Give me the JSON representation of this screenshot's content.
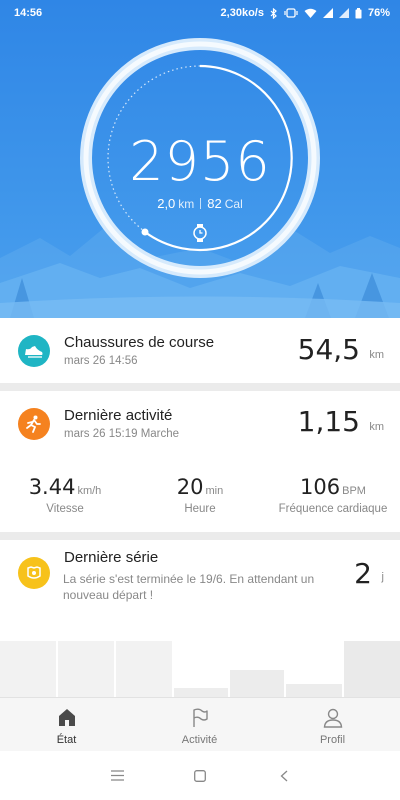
{
  "status_bar": {
    "time": "14:56",
    "network_speed": "2,30ko/s",
    "battery": "76%",
    "icons": [
      "bluetooth-icon",
      "vibrate-icon",
      "wifi-icon",
      "signal-icon",
      "signal-icon",
      "battery-icon"
    ]
  },
  "hero": {
    "steps": "2956",
    "distance_value": "2,0",
    "distance_unit": "km",
    "calories_value": "82",
    "calories_unit": "Cal",
    "device_icon": "watch-icon",
    "colors": {
      "background": "#3d94ea",
      "ring": "#ffffff"
    }
  },
  "shoes": {
    "icon": "shoe-icon",
    "title": "Chaussures de course",
    "subtitle": "mars 26 14:56",
    "value": "54,5",
    "unit": "km",
    "color": "#1fb5c4"
  },
  "activity": {
    "icon": "running-icon",
    "title": "Dernière activité",
    "subtitle": "mars 26 15:19 Marche",
    "value": "1,15",
    "unit": "km",
    "color": "#f5821f",
    "metrics": [
      {
        "value": "3.44",
        "unit": "km/h",
        "label": "Vitesse"
      },
      {
        "value": "20",
        "unit": "min",
        "label": "Heure"
      },
      {
        "value": "106",
        "unit": "BPM",
        "label": "Fréquence cardiaque"
      }
    ]
  },
  "streak": {
    "icon": "badge-icon",
    "title": "Dernière série",
    "description": "La série s'est terminée le 19/6. En attendant un nouveau départ !",
    "value": "2",
    "unit": "j",
    "color": "#f7c21b"
  },
  "bottom_nav": {
    "items": [
      {
        "label": "État",
        "icon": "home-icon",
        "active": true
      },
      {
        "label": "Activité",
        "icon": "flag-icon",
        "active": false
      },
      {
        "label": "Profil",
        "icon": "profile-icon",
        "active": false
      }
    ]
  },
  "system_nav": {
    "icons": [
      "menu-icon",
      "home-square-icon",
      "back-icon"
    ]
  }
}
